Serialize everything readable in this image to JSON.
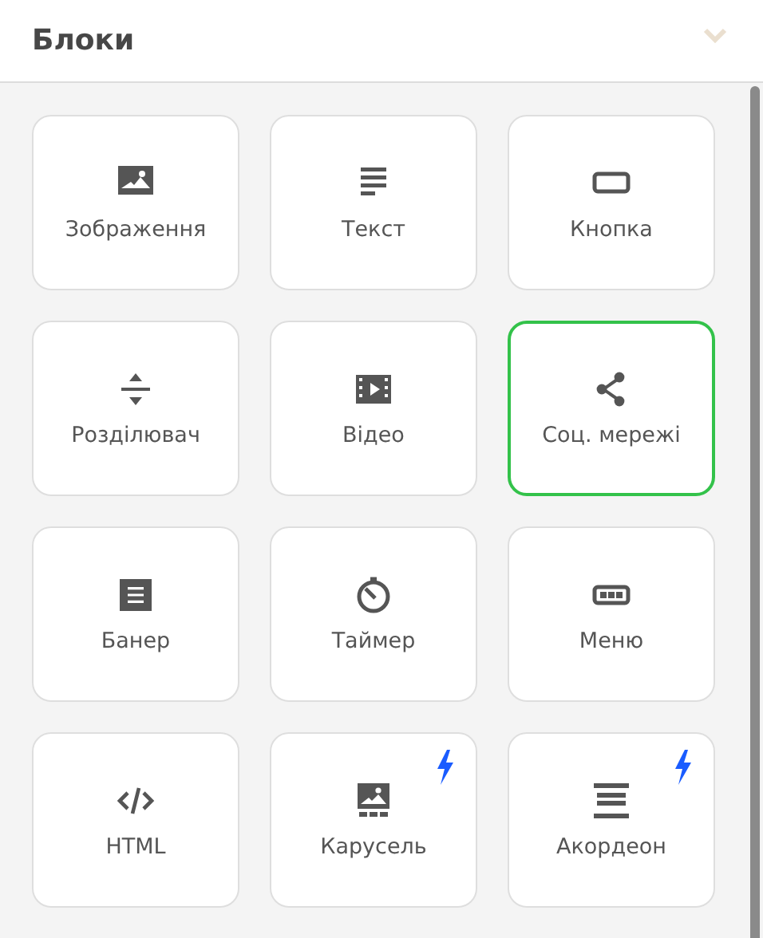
{
  "panel": {
    "title": "Блоки",
    "expanded": true
  },
  "blocks": [
    {
      "label": "Зображення",
      "kind": "image",
      "selected": false,
      "premium": false
    },
    {
      "label": "Текст",
      "kind": "text",
      "selected": false,
      "premium": false
    },
    {
      "label": "Кнопка",
      "kind": "button",
      "selected": false,
      "premium": false
    },
    {
      "label": "Розділювач",
      "kind": "divider",
      "selected": false,
      "premium": false
    },
    {
      "label": "Відео",
      "kind": "video",
      "selected": false,
      "premium": false
    },
    {
      "label": "Соц. мережі",
      "kind": "social",
      "selected": true,
      "premium": false
    },
    {
      "label": "Банер",
      "kind": "banner",
      "selected": false,
      "premium": false
    },
    {
      "label": "Таймер",
      "kind": "timer",
      "selected": false,
      "premium": false
    },
    {
      "label": "Меню",
      "kind": "menu",
      "selected": false,
      "premium": false
    },
    {
      "label": "HTML",
      "kind": "html",
      "selected": false,
      "premium": false
    },
    {
      "label": "Карусель",
      "kind": "carousel",
      "selected": false,
      "premium": true
    },
    {
      "label": "Акордеон",
      "kind": "accordion",
      "selected": false,
      "premium": true
    }
  ]
}
